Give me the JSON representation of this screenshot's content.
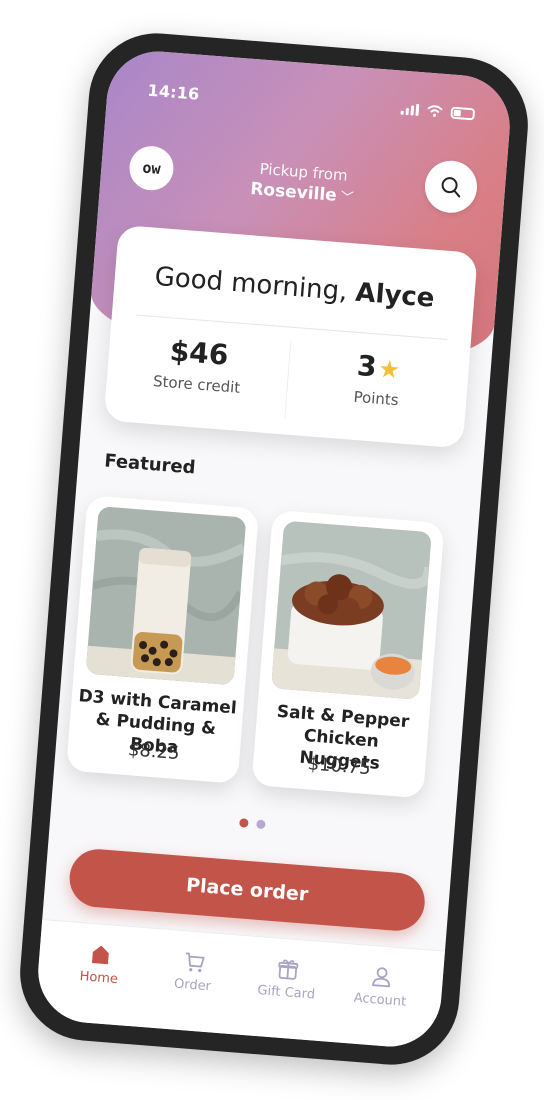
{
  "status": {
    "time": "14:16"
  },
  "header": {
    "avatar_text": "ow",
    "pickup_label": "Pickup from",
    "pickup_location": "Roseville"
  },
  "greeting": {
    "prefix": "Good morning,",
    "name": "Alyce"
  },
  "stats": {
    "store_credit_value": "$46",
    "store_credit_label": "Store credit",
    "points_value": "3",
    "points_label": "Points"
  },
  "featured": {
    "title": "Featured",
    "items": [
      {
        "name": "D3 with Caramel & Pudding & Boba",
        "price": "$8.25"
      },
      {
        "name": "Salt & Pepper Chicken Nuggets",
        "price": "$10.75"
      }
    ],
    "active_page": 1,
    "page_count": 2
  },
  "cta": {
    "label": "Place order"
  },
  "tabs": [
    {
      "label": "Home",
      "icon": "home-icon",
      "active": true
    },
    {
      "label": "Order",
      "icon": "cart-icon",
      "active": false
    },
    {
      "label": "Gift Card",
      "icon": "gift-icon",
      "active": false
    },
    {
      "label": "Account",
      "icon": "person-icon",
      "active": false
    }
  ],
  "colors": {
    "accent": "#c25449",
    "tab_inactive": "#a9a3c4",
    "star": "#f2c032",
    "dot_active": "#c25449",
    "dot_inactive": "#b7a7d6"
  }
}
